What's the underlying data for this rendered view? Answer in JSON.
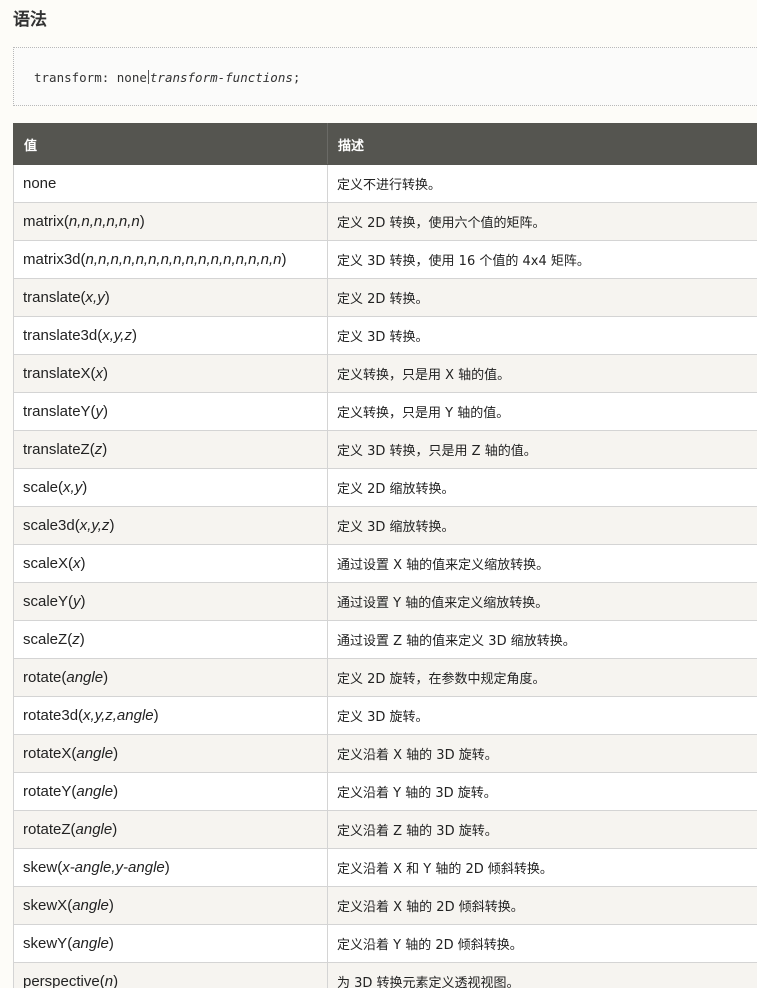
{
  "section": {
    "title": "语法"
  },
  "code": {
    "prefix": "transform: none",
    "italic": "transform-functions",
    "suffix": ";"
  },
  "table": {
    "headers": [
      "值",
      "描述"
    ],
    "rows": [
      {
        "fn": "none",
        "args": "",
        "desc": "定义不进行转换。"
      },
      {
        "fn": "matrix",
        "args": "n,n,n,n,n,n",
        "desc": "定义 2D 转换，使用六个值的矩阵。"
      },
      {
        "fn": "matrix3d",
        "args": "n,n,n,n,n,n,n,n,n,n,n,n,n,n,n,n",
        "desc": "定义 3D 转换，使用 16 个值的 4x4 矩阵。"
      },
      {
        "fn": "translate",
        "args": "x,y",
        "desc": "定义 2D 转换。"
      },
      {
        "fn": "translate3d",
        "args": "x,y,z",
        "desc": "定义 3D 转换。"
      },
      {
        "fn": "translateX",
        "args": "x",
        "desc": "定义转换，只是用 X 轴的值。"
      },
      {
        "fn": "translateY",
        "args": "y",
        "desc": "定义转换，只是用 Y 轴的值。"
      },
      {
        "fn": "translateZ",
        "args": "z",
        "desc": "定义 3D 转换，只是用 Z 轴的值。"
      },
      {
        "fn": "scale",
        "args": "x,y",
        "desc": "定义 2D 缩放转换。"
      },
      {
        "fn": "scale3d",
        "args": "x,y,z",
        "desc": "定义 3D 缩放转换。"
      },
      {
        "fn": "scaleX",
        "args": "x",
        "desc": "通过设置 X 轴的值来定义缩放转换。"
      },
      {
        "fn": "scaleY",
        "args": "y",
        "desc": "通过设置 Y 轴的值来定义缩放转换。"
      },
      {
        "fn": "scaleZ",
        "args": "z",
        "desc": "通过设置 Z 轴的值来定义 3D 缩放转换。"
      },
      {
        "fn": "rotate",
        "args": "angle",
        "desc": "定义 2D 旋转，在参数中规定角度。"
      },
      {
        "fn": "rotate3d",
        "args": "x,y,z,angle",
        "desc": "定义 3D 旋转。"
      },
      {
        "fn": "rotateX",
        "args": "angle",
        "desc": "定义沿着 X 轴的 3D 旋转。"
      },
      {
        "fn": "rotateY",
        "args": "angle",
        "desc": "定义沿着 Y 轴的 3D 旋转。"
      },
      {
        "fn": "rotateZ",
        "args": "angle",
        "desc": "定义沿着 Z 轴的 3D 旋转。"
      },
      {
        "fn": "skew",
        "args": "x-angle,y-angle",
        "desc": "定义沿着 X 和 Y 轴的 2D 倾斜转换。"
      },
      {
        "fn": "skewX",
        "args": "angle",
        "desc": "定义沿着 X 轴的 2D 倾斜转换。"
      },
      {
        "fn": "skewY",
        "args": "angle",
        "desc": "定义沿着 Y 轴的 2D 倾斜转换。"
      },
      {
        "fn": "perspective",
        "args": "n",
        "desc": "为 3D 转换元素定义透视视图。"
      }
    ]
  }
}
